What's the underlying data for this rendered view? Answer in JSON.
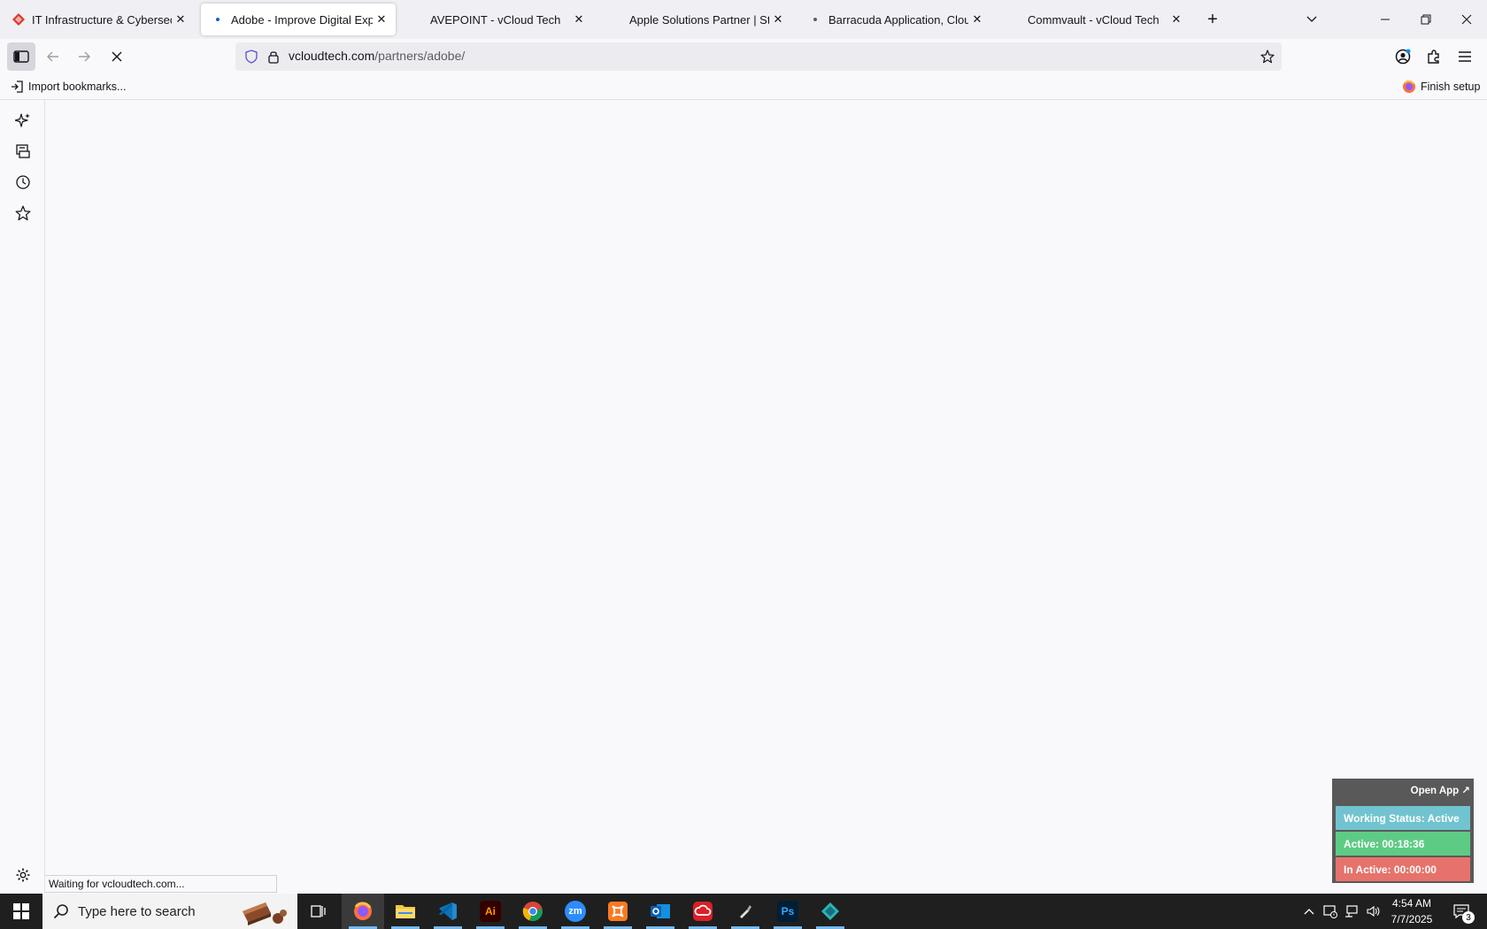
{
  "tabs": [
    {
      "title": "IT Infrastructure & Cybersecurity",
      "favicon": "red-diamond-icon",
      "active": false
    },
    {
      "title": "Adobe - Improve Digital Experience",
      "favicon": "loading-dot-icon",
      "active": true
    },
    {
      "title": "AVEPOINT - vCloud Tech",
      "favicon": "none",
      "active": false
    },
    {
      "title": "Apple Solutions Partner | Streamline",
      "favicon": "none",
      "active": false
    },
    {
      "title": "Barracuda Application, Cloud Security",
      "favicon": "loading-dot-icon",
      "active": false
    },
    {
      "title": "Commvault - vCloud Tech",
      "favicon": "none",
      "active": false
    }
  ],
  "address_bar": {
    "domain": "vcloudtech.com",
    "path": "/partners/adobe/"
  },
  "bookmarks_bar": {
    "import_label": "Import bookmarks...",
    "finish_setup_label": "Finish setup"
  },
  "status_bar": {
    "text": "Waiting for vcloudtech.com..."
  },
  "work_widget": {
    "open_app_label": "Open App ↗",
    "working_status": "Working Status: Active",
    "active_time": "Active: 00:18:36",
    "inactive_time": "In Active: 00:00:00",
    "colors": {
      "status": "#71c4cf",
      "active": "#5ecb85",
      "inactive": "#e5736b"
    }
  },
  "taskbar": {
    "search_placeholder": "Type here to search",
    "apps": [
      "firefox-icon",
      "file-explorer-icon",
      "vscode-icon",
      "illustrator-icon",
      "chrome-icon",
      "zoom-icon",
      "xampp-icon",
      "outlook-icon",
      "creative-cloud-icon",
      "pen-tool-icon",
      "photoshop-icon",
      "app-icon"
    ],
    "ai_label": "Ai",
    "zm_label": "zm",
    "ps_label": "Ps",
    "time": "4:54 AM",
    "date": "7/7/2025",
    "notification_count": "3"
  }
}
